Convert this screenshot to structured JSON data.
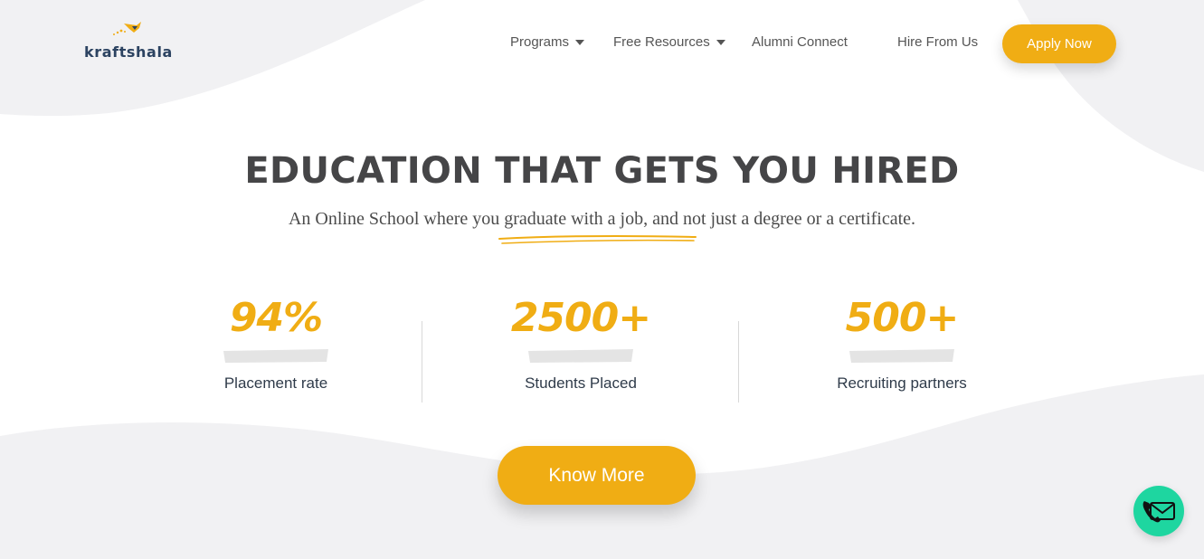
{
  "brand": {
    "name": "kraftshala",
    "accent": "#f0ad14",
    "text_color": "#2c4361"
  },
  "nav": {
    "items": [
      {
        "label": "Programs",
        "has_dropdown": true
      },
      {
        "label": "Free Resources",
        "has_dropdown": true
      },
      {
        "label": "Alumni Connect",
        "has_dropdown": false
      },
      {
        "label": "Hire From Us",
        "has_dropdown": false
      }
    ],
    "cta_label": "Apply Now"
  },
  "hero": {
    "title": "EDUCATION THAT GETS YOU HIRED",
    "subtitle": "An Online School where you graduate with a job, and not just a degree or a certificate."
  },
  "stats": [
    {
      "value": "94%",
      "label": "Placement rate"
    },
    {
      "value": "2500+",
      "label": "Students Placed"
    },
    {
      "value": "500+",
      "label": "Recruiting partners"
    }
  ],
  "cta": {
    "label": "Know More"
  },
  "contact_fab": {
    "icon": "phone-mail-icon",
    "color": "#1ed6a0"
  }
}
